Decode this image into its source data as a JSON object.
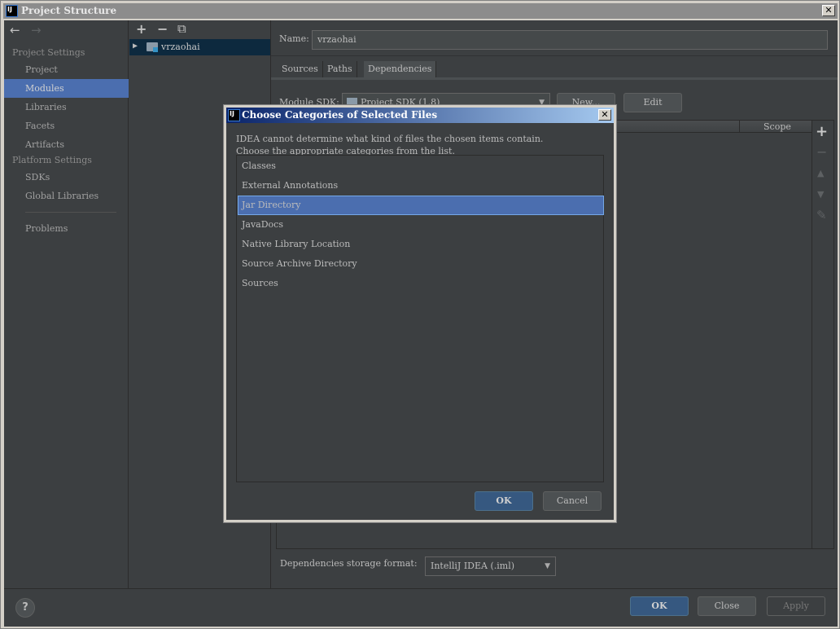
{
  "window": {
    "title": "Project Structure",
    "close_icon": "close-icon"
  },
  "nav": {
    "back": "←",
    "forward": "→"
  },
  "sidebar": {
    "project_settings": "Project Settings",
    "project_items": [
      {
        "label": "Project"
      },
      {
        "label": "Modules",
        "selected": true
      },
      {
        "label": "Libraries"
      },
      {
        "label": "Facets"
      },
      {
        "label": "Artifacts"
      }
    ],
    "platform_settings": "Platform Settings",
    "platform_items": [
      {
        "label": "SDKs"
      },
      {
        "label": "Global Libraries"
      }
    ],
    "problems": "Problems"
  },
  "tree": {
    "toolbar": {
      "add": "+",
      "remove": "−",
      "copy": "⧉"
    },
    "module": "vrzaohai"
  },
  "module": {
    "name_label": "Name:",
    "name_value": "vrzaohai",
    "tabs": [
      {
        "label": "Sources"
      },
      {
        "label": "Paths"
      },
      {
        "label": "Dependencies",
        "active": true
      }
    ],
    "sdk_label": "Module SDK:",
    "sdk_value": "Project SDK (1.8)",
    "new_button": "New...",
    "edit_button": "Edit",
    "table": {
      "columns": [
        "",
        "Scope"
      ]
    },
    "side_toolbar": {
      "add": "+",
      "remove": "−",
      "up": "▲",
      "down": "▼",
      "edit": "✎"
    },
    "storage_label": "Dependencies storage format:",
    "storage_value": "IntelliJ IDEA (.iml)"
  },
  "footer": {
    "help": "?",
    "ok": "OK",
    "close": "Close",
    "apply": "Apply"
  },
  "dialog": {
    "title": "Choose Categories of Selected Files",
    "message_line1": "IDEA cannot determine what kind of files the chosen items contain.",
    "message_line2": "Choose the appropriate categories from the list.",
    "items": [
      {
        "label": "Classes"
      },
      {
        "label": "External Annotations"
      },
      {
        "label": "Jar Directory",
        "selected": true
      },
      {
        "label": "JavaDocs"
      },
      {
        "label": "Native Library Location"
      },
      {
        "label": "Source Archive Directory"
      },
      {
        "label": "Sources"
      }
    ],
    "ok": "OK",
    "cancel": "Cancel"
  },
  "colors": {
    "selection": "#4b6eaf",
    "primary_button": "#365880",
    "panel": "#3c3f41",
    "tree_selection": "#0d293e"
  }
}
